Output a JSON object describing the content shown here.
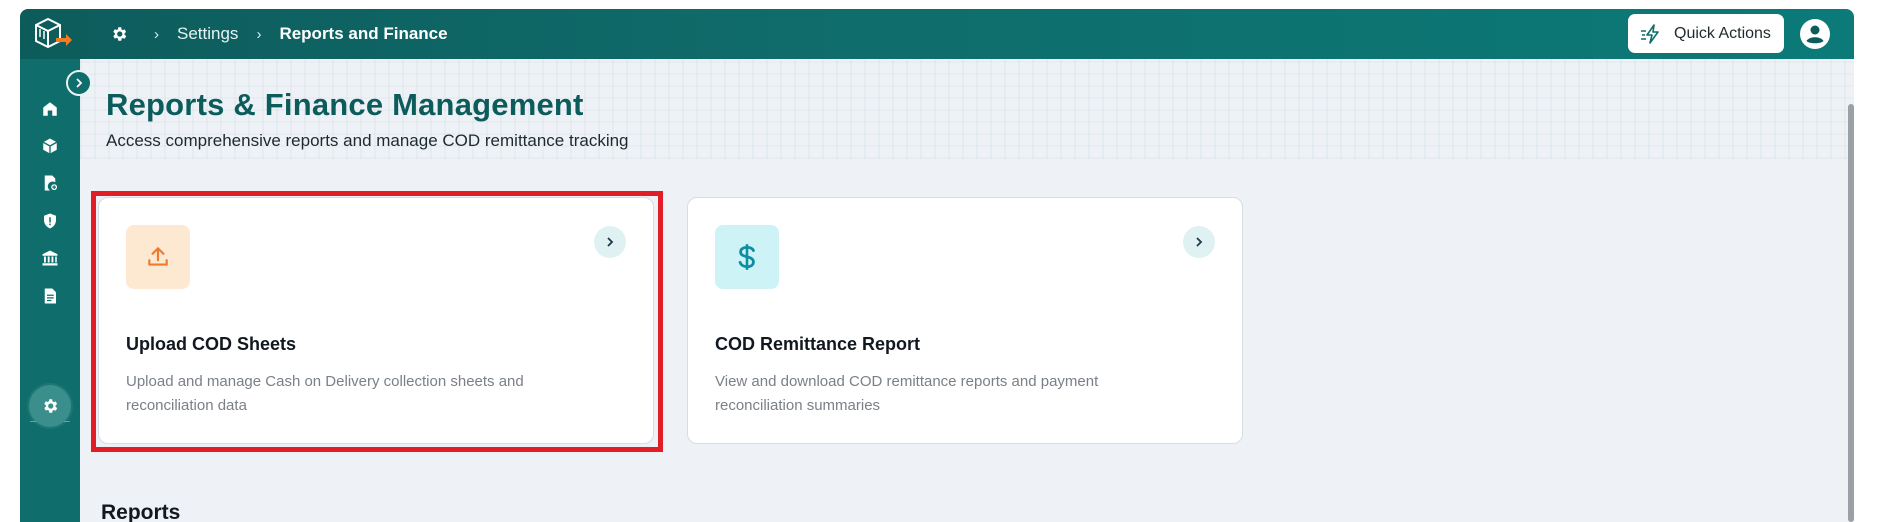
{
  "topbar": {
    "breadcrumb": [
      "Settings",
      "Reports and Finance"
    ],
    "quick_actions_label": "Quick Actions"
  },
  "sidebar": {
    "items": [
      {
        "icon": "home-icon"
      },
      {
        "icon": "package-icon"
      },
      {
        "icon": "add-document-icon"
      },
      {
        "icon": "shield-icon"
      },
      {
        "icon": "bank-icon"
      },
      {
        "icon": "document-icon"
      },
      {
        "icon": "settings-icon",
        "active": true
      }
    ]
  },
  "page": {
    "title": "Reports & Finance Management",
    "subtitle": "Access comprehensive reports and manage COD remittance tracking"
  },
  "cards": [
    {
      "title": "Upload COD Sheets",
      "description": "Upload and manage Cash on Delivery collection sheets and reconciliation data",
      "icon": "upload-icon",
      "accent": "#f07a2c"
    },
    {
      "title": "COD Remittance Report",
      "description": "View and download COD remittance reports and payment reconciliation summaries",
      "icon": "dollar-icon",
      "accent": "#0e8fa1"
    }
  ],
  "sections": {
    "reports_heading": "Reports"
  },
  "colors": {
    "brand": "#0d5c5c",
    "highlight": "#e11d25"
  }
}
